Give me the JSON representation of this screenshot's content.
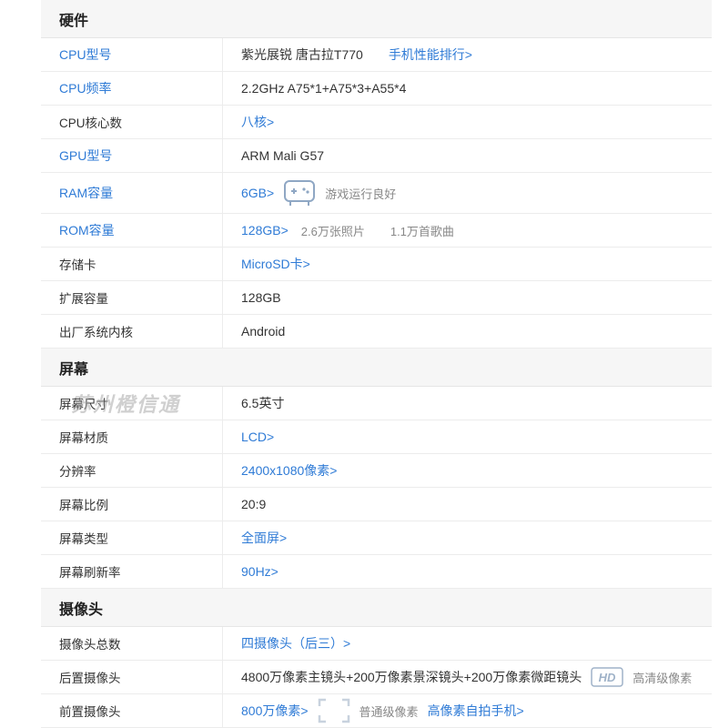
{
  "hardware": {
    "title": "硬件",
    "cpu_model": {
      "label": "CPU型号",
      "value": "紫光展锐 唐古拉T770",
      "link": "手机性能排行>"
    },
    "cpu_freq": {
      "label": "CPU频率",
      "value": "2.2GHz A75*1+A75*3+A55*4"
    },
    "cpu_cores": {
      "label": "CPU核心数",
      "value": "八核>"
    },
    "gpu": {
      "label": "GPU型号",
      "value": "ARM Mali G57"
    },
    "ram": {
      "label": "RAM容量",
      "value": "6GB>",
      "note": "游戏运行良好",
      "icon": "gamepad-icon"
    },
    "rom": {
      "label": "ROM容量",
      "value": "128GB>",
      "note1": "2.6万张照片",
      "note2": "1.1万首歌曲"
    },
    "card": {
      "label": "存储卡",
      "value": "MicroSD卡>"
    },
    "expand": {
      "label": "扩展容量",
      "value": "128GB"
    },
    "os": {
      "label": "出厂系统内核",
      "value": "Android"
    }
  },
  "screen": {
    "title": "屏幕",
    "size": {
      "label": "屏幕尺寸",
      "value": "6.5英寸"
    },
    "material": {
      "label": "屏幕材质",
      "value": "LCD>"
    },
    "resolution": {
      "label": "分辨率",
      "value": "2400x1080像素>"
    },
    "ratio": {
      "label": "屏幕比例",
      "value": "20:9"
    },
    "type": {
      "label": "屏幕类型",
      "value": "全面屏>"
    },
    "refresh": {
      "label": "屏幕刷新率",
      "value": "90Hz>"
    }
  },
  "camera": {
    "title": "摄像头",
    "total": {
      "label": "摄像头总数",
      "value": "四摄像头（后三）>"
    },
    "rear": {
      "label": "后置摄像头",
      "value": "4800万像素主镜头+200万像素景深镜头+200万像素微距镜头",
      "badge": "HD",
      "note": "高清级像素",
      "icon": "hd-icon"
    },
    "front": {
      "label": "前置摄像头",
      "value": "800万像素>",
      "note": "普通级像素",
      "link": "高像素自拍手机>",
      "icon": "frame-icon"
    }
  },
  "watermark": "苏州橙信通",
  "colors": {
    "link": "#2f7bd6",
    "header_bg": "#f6f6f6",
    "border": "#ececec"
  }
}
